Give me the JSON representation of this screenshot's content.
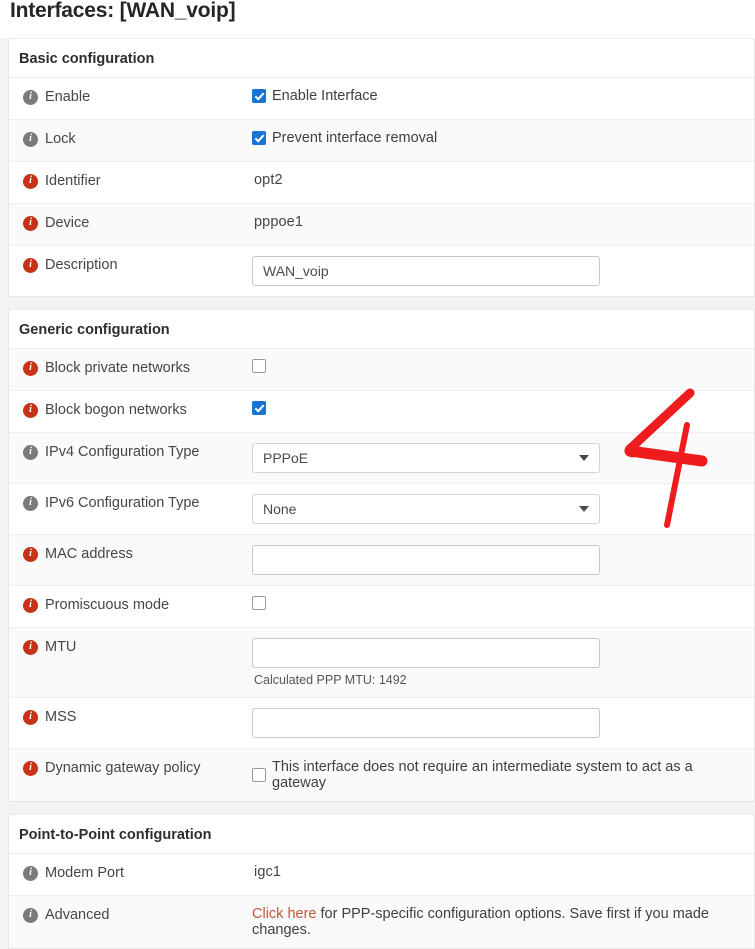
{
  "page": {
    "title": "Interfaces: [WAN_voip]"
  },
  "sections": [
    {
      "heading": "Basic configuration",
      "rows": [
        {
          "label": "Enable",
          "icon": "info-icon-gray",
          "type": "checkbox",
          "checked": true,
          "text": "Enable Interface"
        },
        {
          "label": "Lock",
          "icon": "info-icon-gray",
          "type": "checkbox",
          "checked": true,
          "text": "Prevent interface removal"
        },
        {
          "label": "Identifier",
          "icon": "info-icon-red",
          "type": "text",
          "value": "opt2"
        },
        {
          "label": "Device",
          "icon": "info-icon-red",
          "type": "text",
          "value": "pppoe1"
        },
        {
          "label": "Description",
          "icon": "info-icon-red",
          "type": "input",
          "value": "WAN_voip"
        }
      ]
    },
    {
      "heading": "Generic configuration",
      "rows": [
        {
          "label": "Block private networks",
          "icon": "info-icon-red",
          "type": "checkbox",
          "checked": false,
          "text": ""
        },
        {
          "label": "Block bogon networks",
          "icon": "info-icon-red",
          "type": "checkbox",
          "checked": true,
          "text": ""
        },
        {
          "label": "IPv4 Configuration Type",
          "icon": "info-icon-gray",
          "type": "select",
          "value": "PPPoE"
        },
        {
          "label": "IPv6 Configuration Type",
          "icon": "info-icon-gray",
          "type": "select",
          "value": "None"
        },
        {
          "label": "MAC address",
          "icon": "info-icon-red",
          "type": "input",
          "value": ""
        },
        {
          "label": "Promiscuous mode",
          "icon": "info-icon-red",
          "type": "checkbox",
          "checked": false,
          "text": ""
        },
        {
          "label": "MTU",
          "icon": "info-icon-red",
          "type": "input",
          "value": "",
          "hint": "Calculated PPP MTU: 1492"
        },
        {
          "label": "MSS",
          "icon": "info-icon-red",
          "type": "input",
          "value": ""
        },
        {
          "label": "Dynamic gateway policy",
          "icon": "info-icon-red",
          "type": "checkbox",
          "checked": false,
          "text": "This interface does not require an intermediate system to act as a gateway"
        }
      ]
    },
    {
      "heading": "Point-to-Point configuration",
      "rows": [
        {
          "label": "Modem Port",
          "icon": "info-icon-gray",
          "type": "text",
          "value": "igc1"
        },
        {
          "label": "Advanced",
          "icon": "info-icon-gray",
          "type": "link",
          "link_text": "Click here",
          "after_text": " for PPP-specific configuration options. Save first if you made changes."
        }
      ]
    }
  ],
  "annotation": {
    "mark": "4",
    "color": "#ee1c1c"
  },
  "colors": {
    "accent_blue": "#1a73d2",
    "info_red": "#c63217",
    "info_gray": "#7a7a7a",
    "link_red": "#c0573c",
    "page_bg": "#f3f3f3"
  },
  "icon_glyph": "i"
}
